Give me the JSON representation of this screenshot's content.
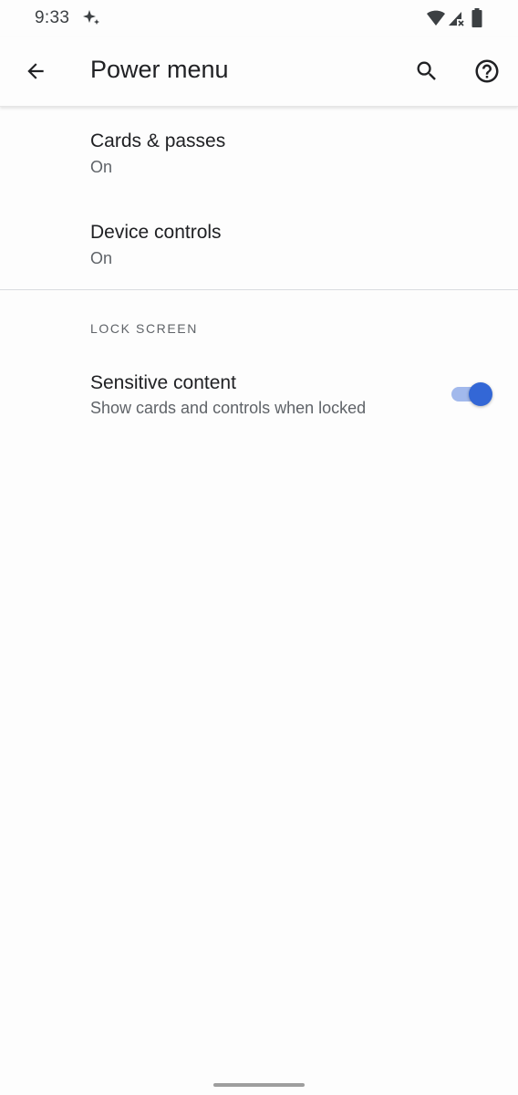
{
  "status_bar": {
    "time": "9:33",
    "icons": [
      "sparkle-icon",
      "wifi-icon",
      "signal-icon",
      "battery-icon"
    ]
  },
  "app_bar": {
    "title": "Power menu",
    "back_icon": "arrow-back-icon",
    "search_icon": "search-icon",
    "help_icon": "help-icon"
  },
  "preferences": [
    {
      "title": "Cards & passes",
      "summary": "On"
    },
    {
      "title": "Device controls",
      "summary": "On"
    }
  ],
  "lock_screen": {
    "header": "LOCK SCREEN",
    "item": {
      "title": "Sensitive content",
      "summary": "Show cards and controls when locked",
      "enabled": true
    }
  },
  "colors": {
    "accent": "#3367d6",
    "text_primary": "#202124",
    "text_secondary": "#5f6368",
    "icon": "#202124"
  }
}
